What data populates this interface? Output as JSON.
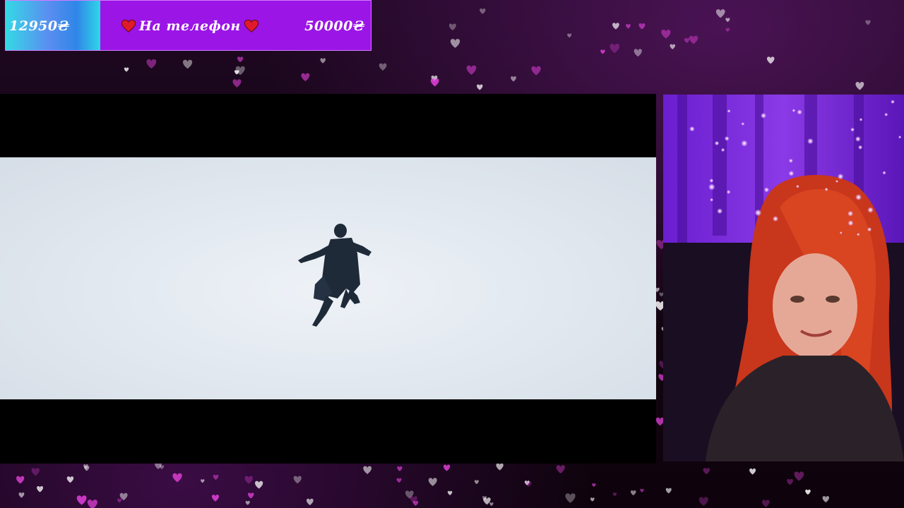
{
  "donation_goal": {
    "current_amount": "12950₴",
    "title": "На телефон",
    "target_amount": "50000₴",
    "progress_fraction": 0.259,
    "fill_color": "#35d8e6",
    "bar_color": "#9a15e6",
    "heart_icon": "red-heart-icon"
  },
  "video_player": {
    "content": "figure falling through white sky",
    "scene_color": "#dfe6ee"
  },
  "webcam": {
    "background_color": "#7a25d8"
  },
  "overlay": {
    "decoration": "floating-pink-hearts",
    "heart_color": "#e040d8"
  }
}
